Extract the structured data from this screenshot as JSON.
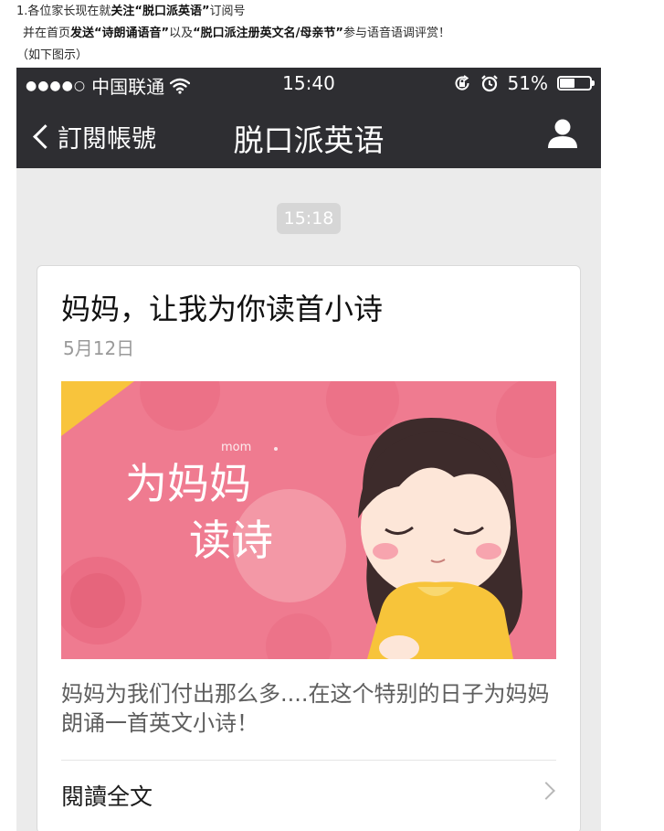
{
  "intro": {
    "line1": {
      "prefix": "1.各位家长现在就",
      "bold": "关注“脱口派英语”",
      "suffix": "订阅号"
    },
    "line2": {
      "prefix": "并在首页",
      "bold1": "发送“诗朗诵语音”",
      "mid": "以及",
      "bold2": "“脱口派注册英文名/母亲节”",
      "suffix": "参与语音语调评赏！"
    },
    "line3": "（如下图示）"
  },
  "statusbar": {
    "signal_dots": "●●●●○",
    "carrier": "中国联通",
    "wifi_icon": "wifi-icon",
    "time": "15:40",
    "lock_rotation_icon": "rotation-lock-icon",
    "alarm_icon": "alarm-icon",
    "battery_percent": "51%",
    "battery_level": 0.51
  },
  "navbar": {
    "back_label": "訂閱帳號",
    "title": "脱口派英语",
    "user_icon": "user-icon"
  },
  "chat": {
    "timestamp": "15:18"
  },
  "article": {
    "title": "妈妈，让我为你读首小诗",
    "date": "5月12日",
    "banner": {
      "line1": "为妈妈",
      "line2": "读诗",
      "small": "mom"
    },
    "description": "妈妈为我们付出那么多....在这个特别的日子为妈妈朗诵一首英文小诗！",
    "read_more": "閱讀全文"
  },
  "colors": {
    "nav_bg": "#2e2e32",
    "chat_bg": "#ebebeb",
    "banner_pink": "#ef7b90",
    "sweater_yellow": "#f7c43a"
  }
}
